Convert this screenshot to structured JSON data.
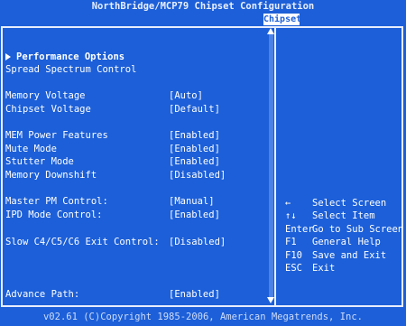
{
  "window": {
    "title": "NorthBridge/MCP79 Chipset Configuration",
    "tab": "Chipset"
  },
  "submenus": [
    {
      "label": "Performance Options"
    },
    {
      "label": "Spread Spectrum Control"
    }
  ],
  "settings": [
    {
      "label": "Memory Voltage",
      "value": "[Auto]"
    },
    {
      "label": "Chipset Voltage",
      "value": "[Default]"
    },
    {
      "label": "MEM Power Features",
      "value": "[Enabled]"
    },
    {
      "label": "Mute Mode",
      "value": "[Enabled]"
    },
    {
      "label": "Stutter Mode",
      "value": "[Enabled]"
    },
    {
      "label": "Memory Downshift",
      "value": "[Disabled]"
    },
    {
      "label": "Master PM Control:",
      "value": "[Manual]"
    },
    {
      "label": "IPD Mode Control:",
      "value": "[Enabled]"
    },
    {
      "label": "Slow C4/C5/C6 Exit Control:",
      "value": "[Disabled]"
    },
    {
      "label": "Advance Path:",
      "value": "[Enabled]"
    }
  ],
  "help": [
    {
      "key": "←",
      "desc": "Select Screen"
    },
    {
      "key": "↑↓",
      "desc": "Select Item"
    },
    {
      "key": "Enter",
      "desc": "Go to Sub Screen"
    },
    {
      "key": "F1",
      "desc": "General Help"
    },
    {
      "key": "F10",
      "desc": "Save and Exit"
    },
    {
      "key": "ESC",
      "desc": "Exit"
    }
  ],
  "footer": {
    "text": "v02.61 (C)Copyright 1985-2006, American Megatrends, Inc."
  },
  "colors": {
    "background": "#1c5fd8",
    "highlight": "#ffffff",
    "text": "#ffffff"
  }
}
